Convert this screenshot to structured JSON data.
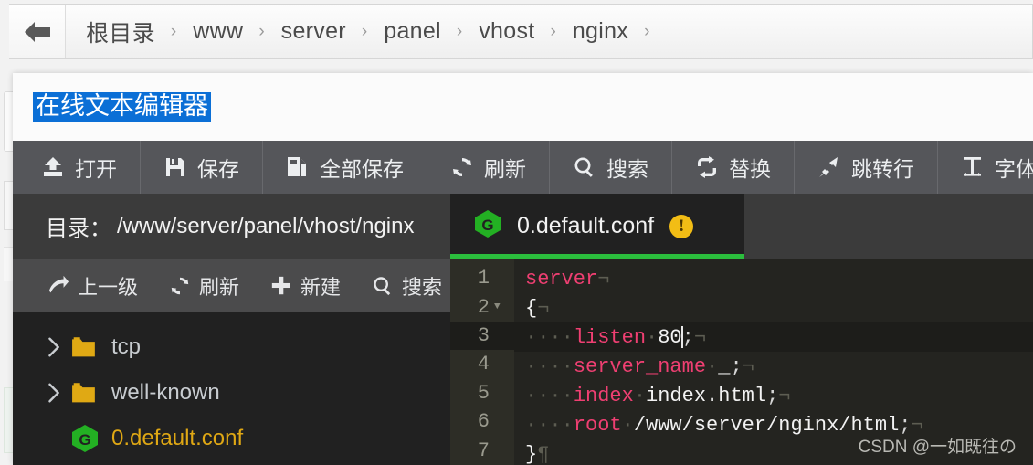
{
  "breadcrumb": {
    "back_icon": "arrow-left-icon",
    "separator": "›",
    "items": [
      {
        "label": "根目录"
      },
      {
        "label": "www"
      },
      {
        "label": "server"
      },
      {
        "label": "panel"
      },
      {
        "label": "vhost"
      },
      {
        "label": "nginx"
      }
    ]
  },
  "modal": {
    "title": "在线文本编辑器",
    "title_highlight_color": "#0b6fd6"
  },
  "toolbar": {
    "items": [
      {
        "label": "打开",
        "icon": "upload-icon"
      },
      {
        "label": "保存",
        "icon": "floppy-save-icon"
      },
      {
        "label": "全部保存",
        "icon": "save-all-icon"
      },
      {
        "label": "刷新",
        "icon": "refresh-icon"
      },
      {
        "label": "搜索",
        "icon": "search-icon"
      },
      {
        "label": "替换",
        "icon": "swap-replace-icon"
      },
      {
        "label": "跳转行",
        "icon": "pin-icon"
      },
      {
        "label": "字体",
        "icon": "font-size-icon"
      }
    ]
  },
  "filebrowser": {
    "dir_label": "目录：",
    "dir_path": "/www/server/panel/vhost/nginx",
    "tools": [
      {
        "label": "上一级",
        "icon": "arrow-up-level-icon"
      },
      {
        "label": "刷新",
        "icon": "refresh-icon"
      },
      {
        "label": "新建",
        "icon": "plus-icon"
      },
      {
        "label": "搜索",
        "icon": "search-icon"
      }
    ],
    "tree": [
      {
        "name": "tcp",
        "type": "folder",
        "expandable": true,
        "icon": "folder-icon"
      },
      {
        "name": "well-known",
        "type": "folder",
        "expandable": true,
        "icon": "folder-icon"
      },
      {
        "name": "0.default.conf",
        "type": "file",
        "expandable": false,
        "icon": "nginx-logo-icon"
      }
    ]
  },
  "editor": {
    "tab": {
      "icon": "nginx-logo-icon",
      "filename": "0.default.conf",
      "modified_badge": "!",
      "badge_color": "#f2bd15",
      "underline_color": "#2bbe3d"
    },
    "active_line": 3,
    "lines": [
      {
        "num": "1",
        "foldable": false,
        "active": false,
        "tokens": [
          {
            "t": "server",
            "c": "kw"
          },
          {
            "t": "¬",
            "c": "eol"
          }
        ]
      },
      {
        "num": "2",
        "foldable": true,
        "active": false,
        "tokens": [
          {
            "t": "{",
            "c": "val"
          },
          {
            "t": "¬",
            "c": "eol"
          }
        ]
      },
      {
        "num": "3",
        "foldable": false,
        "active": true,
        "tokens": [
          {
            "t": "····",
            "c": "ws"
          },
          {
            "t": "listen",
            "c": "kw"
          },
          {
            "t": "·",
            "c": "ws"
          },
          {
            "t": "80",
            "c": "val"
          },
          {
            "t": "|CARET|",
            "c": "caret"
          },
          {
            "t": ";",
            "c": "punc"
          },
          {
            "t": "¬",
            "c": "eol"
          }
        ]
      },
      {
        "num": "4",
        "foldable": false,
        "active": false,
        "tokens": [
          {
            "t": "····",
            "c": "ws"
          },
          {
            "t": "server_name",
            "c": "kw"
          },
          {
            "t": "·",
            "c": "ws"
          },
          {
            "t": "_",
            "c": "val"
          },
          {
            "t": ";",
            "c": "punc"
          },
          {
            "t": "¬",
            "c": "eol"
          }
        ]
      },
      {
        "num": "5",
        "foldable": false,
        "active": false,
        "tokens": [
          {
            "t": "····",
            "c": "ws"
          },
          {
            "t": "index",
            "c": "kw"
          },
          {
            "t": "·",
            "c": "ws"
          },
          {
            "t": "index.html",
            "c": "val"
          },
          {
            "t": ";",
            "c": "punc"
          },
          {
            "t": "¬",
            "c": "eol"
          }
        ]
      },
      {
        "num": "6",
        "foldable": false,
        "active": false,
        "tokens": [
          {
            "t": "····",
            "c": "ws"
          },
          {
            "t": "root",
            "c": "kw"
          },
          {
            "t": "·",
            "c": "ws"
          },
          {
            "t": "/www/server/nginx/html",
            "c": "val"
          },
          {
            "t": ";",
            "c": "punc"
          },
          {
            "t": "¬",
            "c": "eol"
          }
        ]
      },
      {
        "num": "7",
        "foldable": false,
        "active": false,
        "tokens": [
          {
            "t": "}",
            "c": "val"
          },
          {
            "t": "¶",
            "c": "eol"
          }
        ]
      }
    ]
  },
  "watermark": "CSDN @一如既往の"
}
